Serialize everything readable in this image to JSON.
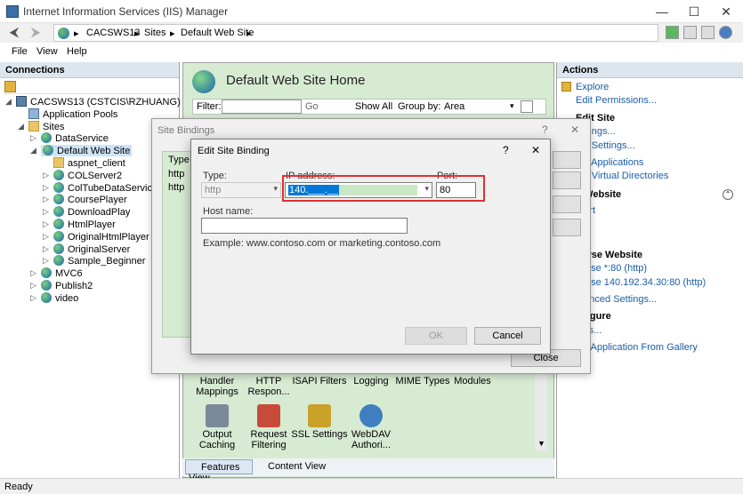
{
  "window": {
    "title": "Internet Information Services (IIS) Manager",
    "controls": {
      "minimize": "—",
      "maximize": "☐",
      "close": "✕"
    }
  },
  "address": {
    "crumbs": [
      "CACSWS13",
      "Sites",
      "Default Web Site"
    ],
    "separator": "▸"
  },
  "menu": {
    "file": "File",
    "view": "View",
    "help": "Help"
  },
  "connections": {
    "header": "Connections",
    "tree": [
      {
        "label": "CACSWS13 (CSTCIS\\RZHUANG)",
        "icon": "server-icon"
      },
      {
        "label": "Application Pools",
        "icon": "apppool-icon"
      },
      {
        "label": "Sites",
        "icon": "folder-icon"
      },
      {
        "label": "DataService",
        "icon": "globe-icon"
      },
      {
        "label": "Default Web Site",
        "icon": "globe-icon"
      },
      {
        "label": "aspnet_client",
        "icon": "folder-icon"
      },
      {
        "label": "COLServer2",
        "icon": "globe-icon"
      },
      {
        "label": "ColTubeDataService",
        "icon": "globe-icon"
      },
      {
        "label": "CoursePlayer",
        "icon": "globe-icon"
      },
      {
        "label": "DownloadPlay",
        "icon": "globe-icon"
      },
      {
        "label": "HtmlPlayer",
        "icon": "globe-icon"
      },
      {
        "label": "OriginalHtmlPlayer",
        "icon": "globe-icon"
      },
      {
        "label": "OriginalServer",
        "icon": "globe-icon"
      },
      {
        "label": "Sample_Beginner",
        "icon": "globe-icon"
      },
      {
        "label": "MVC6",
        "icon": "globe-icon"
      },
      {
        "label": "Publish2",
        "icon": "globe-icon"
      },
      {
        "label": "video",
        "icon": "globe-icon"
      }
    ]
  },
  "center": {
    "heading": "Default Web Site Home",
    "filter_label": "Filter:",
    "go_label": "Go",
    "show_all_label": "Show All",
    "group_by_label": "Group by:",
    "group_by_value": "Area",
    "features_row1": [
      "Handler Mappings",
      "HTTP Respon...",
      "ISAPI Filters",
      "Logging",
      "MIME Types",
      "Modules"
    ],
    "features_row2": [
      "Output Caching",
      "Request Filtering",
      "SSL Settings",
      "WebDAV Authori..."
    ],
    "tab_features": "Features View",
    "tab_content": "Content View"
  },
  "actions": {
    "header": "Actions",
    "items": [
      {
        "text": "Explore",
        "kind": "link"
      },
      {
        "text": "Edit Permissions...",
        "kind": "link"
      },
      {
        "text": "Edit Site",
        "kind": "head"
      },
      {
        "text": "...dings...",
        "kind": "link"
      },
      {
        "text": "...c Settings...",
        "kind": "link"
      },
      {
        "text": "...v Applications",
        "kind": "link"
      },
      {
        "text": "...v Virtual Directories",
        "kind": "link"
      },
      {
        "text": "...Website",
        "kind": "head"
      },
      {
        "text": "...art",
        "kind": "link"
      },
      {
        "text": "...wse Website",
        "kind": "head"
      },
      {
        "text": "...wse *:80 (http)",
        "kind": "link"
      },
      {
        "text": "...wse 140.192.34.30:80 (http)",
        "kind": "link"
      },
      {
        "text": "...anced Settings...",
        "kind": "link"
      },
      {
        "text": "...figure",
        "kind": "head"
      },
      {
        "text": "...its...",
        "kind": "link"
      },
      {
        "text": "...ll Application From Gallery",
        "kind": "link"
      }
    ]
  },
  "site_bindings": {
    "title": "Site Bindings",
    "help_glyph": "?",
    "close_glyph": "✕",
    "col_type": "Type",
    "rows": [
      "http",
      "http"
    ],
    "close_button": "Close"
  },
  "edit_binding": {
    "title": "Edit Site Binding",
    "help_glyph": "?",
    "close_glyph": "✕",
    "type_label": "Type:",
    "type_value": "http",
    "ip_label": "IP address:",
    "ip_value": "140.___.__.__",
    "port_label": "Port:",
    "port_value": "80",
    "host_label": "Host name:",
    "host_value": "",
    "example": "Example: www.contoso.com or marketing.contoso.com",
    "ok_label": "OK",
    "cancel_label": "Cancel"
  },
  "status": {
    "text": "Ready"
  }
}
